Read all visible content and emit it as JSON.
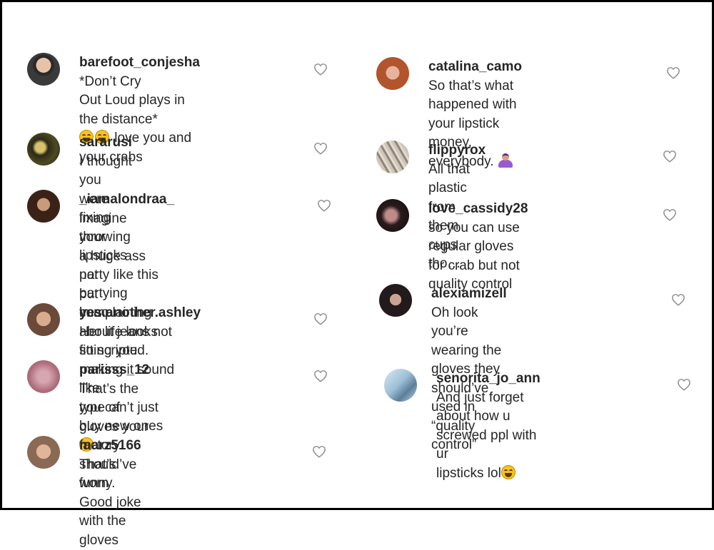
{
  "left": [
    {
      "id": "c1",
      "username": "barefoot_conjesha",
      "lines": [
        "*Don’t Cry",
        "Out Loud plays in the distance*",
        "love you and your crabs"
      ],
      "emoji": [
        "laugh",
        "laugh"
      ]
    },
    {
      "id": "c2",
      "username": "sararusi",
      "lines": [
        "I thought you were fixing",
        "your lipsticks not partying lmao"
      ]
    },
    {
      "id": "c3",
      "username": "_iamalondraa_",
      "lines": [
        "imagine throwing",
        "a huge ass party like this but",
        "complaining about jeans not",
        "fitting you making it sound like",
        "you can’t just buy new ones"
      ],
      "emoji": [
        "smirk"
      ]
    },
    {
      "id": "c4",
      "username": "yes.another.ashley",
      "lines": [
        "Her life looks",
        "so scripted."
      ]
    },
    {
      "id": "c5",
      "username": "parisss_12",
      "lines": [
        "That’s the type of",
        "gloves your factory should’ve",
        "worn"
      ]
    },
    {
      "id": "c6",
      "username": "marz5166",
      "lines": [
        "That’s funny. Good joke",
        "with the gloves"
      ]
    }
  ],
  "right": [
    {
      "id": "c7",
      "username": "catalina_camo",
      "lines": [
        "So that’s what",
        "happened with your lipstick",
        "money, everybody."
      ],
      "emoji": [
        "shrug"
      ]
    },
    {
      "id": "c8",
      "username": "flippyrox",
      "lines": [
        "All that plastic from",
        "them cups tho…"
      ]
    },
    {
      "id": "c9",
      "username": "love_cassidy28",
      "lines": [
        "so you can use",
        "regular gloves for crab but not",
        "quality control"
      ]
    },
    {
      "id": "c10",
      "username": "alexiamizell",
      "lines": [
        "Oh look you’re",
        "wearing the gloves they should’ve",
        "used in “quality control”"
      ]
    },
    {
      "id": "c11",
      "username": "senorita_jo_ann",
      "lines": [
        "And just forget",
        "about how u screwed ppl with ur",
        "lipsticks lol"
      ],
      "emoji": [
        "laugh"
      ]
    }
  ],
  "colors": {
    "text": "#262626",
    "heart": "#8e8e8e",
    "border": "#000000"
  },
  "icons": {
    "like": "heart-icon"
  }
}
